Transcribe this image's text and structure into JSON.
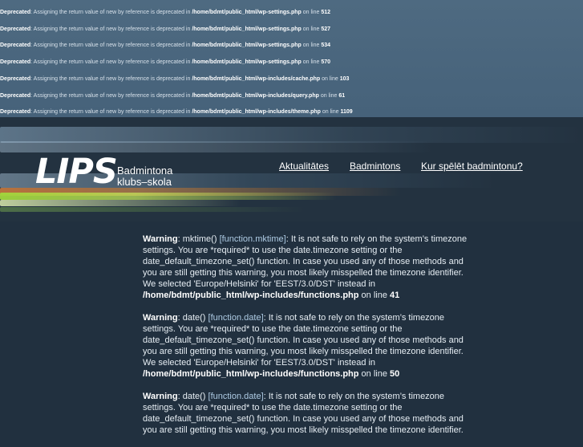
{
  "deprecated_notices": [
    {
      "label": "Deprecated",
      "message": ": Assigning the return value of new by reference is deprecated in ",
      "path": "/home/bdmt/public_html/wp-settings.php",
      "line_text": " on line ",
      "line": "512"
    },
    {
      "label": "Deprecated",
      "message": ": Assigning the return value of new by reference is deprecated in ",
      "path": "/home/bdmt/public_html/wp-settings.php",
      "line_text": " on line ",
      "line": "527"
    },
    {
      "label": "Deprecated",
      "message": ": Assigning the return value of new by reference is deprecated in ",
      "path": "/home/bdmt/public_html/wp-settings.php",
      "line_text": " on line ",
      "line": "534"
    },
    {
      "label": "Deprecated",
      "message": ": Assigning the return value of new by reference is deprecated in ",
      "path": "/home/bdmt/public_html/wp-settings.php",
      "line_text": " on line ",
      "line": "570"
    },
    {
      "label": "Deprecated",
      "message": ": Assigning the return value of new by reference is deprecated in ",
      "path": "/home/bdmt/public_html/wp-includes/cache.php",
      "line_text": " on line ",
      "line": "103"
    },
    {
      "label": "Deprecated",
      "message": ": Assigning the return value of new by reference is deprecated in ",
      "path": "/home/bdmt/public_html/wp-includes/query.php",
      "line_text": " on line ",
      "line": "61"
    },
    {
      "label": "Deprecated",
      "message": ": Assigning the return value of new by reference is deprecated in ",
      "path": "/home/bdmt/public_html/wp-includes/theme.php",
      "line_text": " on line ",
      "line": "1109"
    }
  ],
  "header": {
    "logo": "LIPS",
    "subtitle_line1": "Badmintona",
    "subtitle_line2": "klubs–skola",
    "nav": [
      "Aktualitātes",
      "Badmintons",
      "Kur spēlēt badmintonu?"
    ]
  },
  "warnings": [
    {
      "label": "Warning",
      "func": "mktime()",
      "func_link": "[function.mktime]",
      "message": ": It is not safe to rely on the system’s timezone settings. You are *required* to use the date.timezone setting or the date_default_timezone_set() function. In case you used any of those methods and you are still getting this warning, you most likely misspelled the timezone identifier. We selected 'Europe/Helsinki' for 'EEST/3.0/DST' instead in ",
      "path": "/home/bdmt/public_html/wp-includes/functions.php",
      "line_text": " on line ",
      "line": "41"
    },
    {
      "label": "Warning",
      "func": "date()",
      "func_link": "[function.date]",
      "message": ": It is not safe to rely on the system’s timezone settings. You are *required* to use the date.timezone setting or the date_default_timezone_set() function. In case you used any of those methods and you are still getting this warning, you most likely misspelled the timezone identifier. We selected 'Europe/Helsinki' for 'EEST/3.0/DST' instead in ",
      "path": "/home/bdmt/public_html/wp-includes/functions.php",
      "line_text": " on line ",
      "line": "50"
    },
    {
      "label": "Warning",
      "func": "date()",
      "func_link": "[function.date]",
      "message": ": It is not safe to rely on the system’s timezone settings. You are *required* to use the date.timezone setting or the date_default_timezone_set() function. In case you used any of those methods and you are still getting this warning, you most likely misspelled the timezone identifier.",
      "path": "",
      "line_text": "",
      "line": ""
    }
  ],
  "colors": {
    "deprecated_bg": "#4e6a81",
    "page_bg": "#21303f",
    "streak_green": "#9fd43a",
    "streak_orange": "#e08a3a",
    "link_blue": "#aecbe4"
  }
}
